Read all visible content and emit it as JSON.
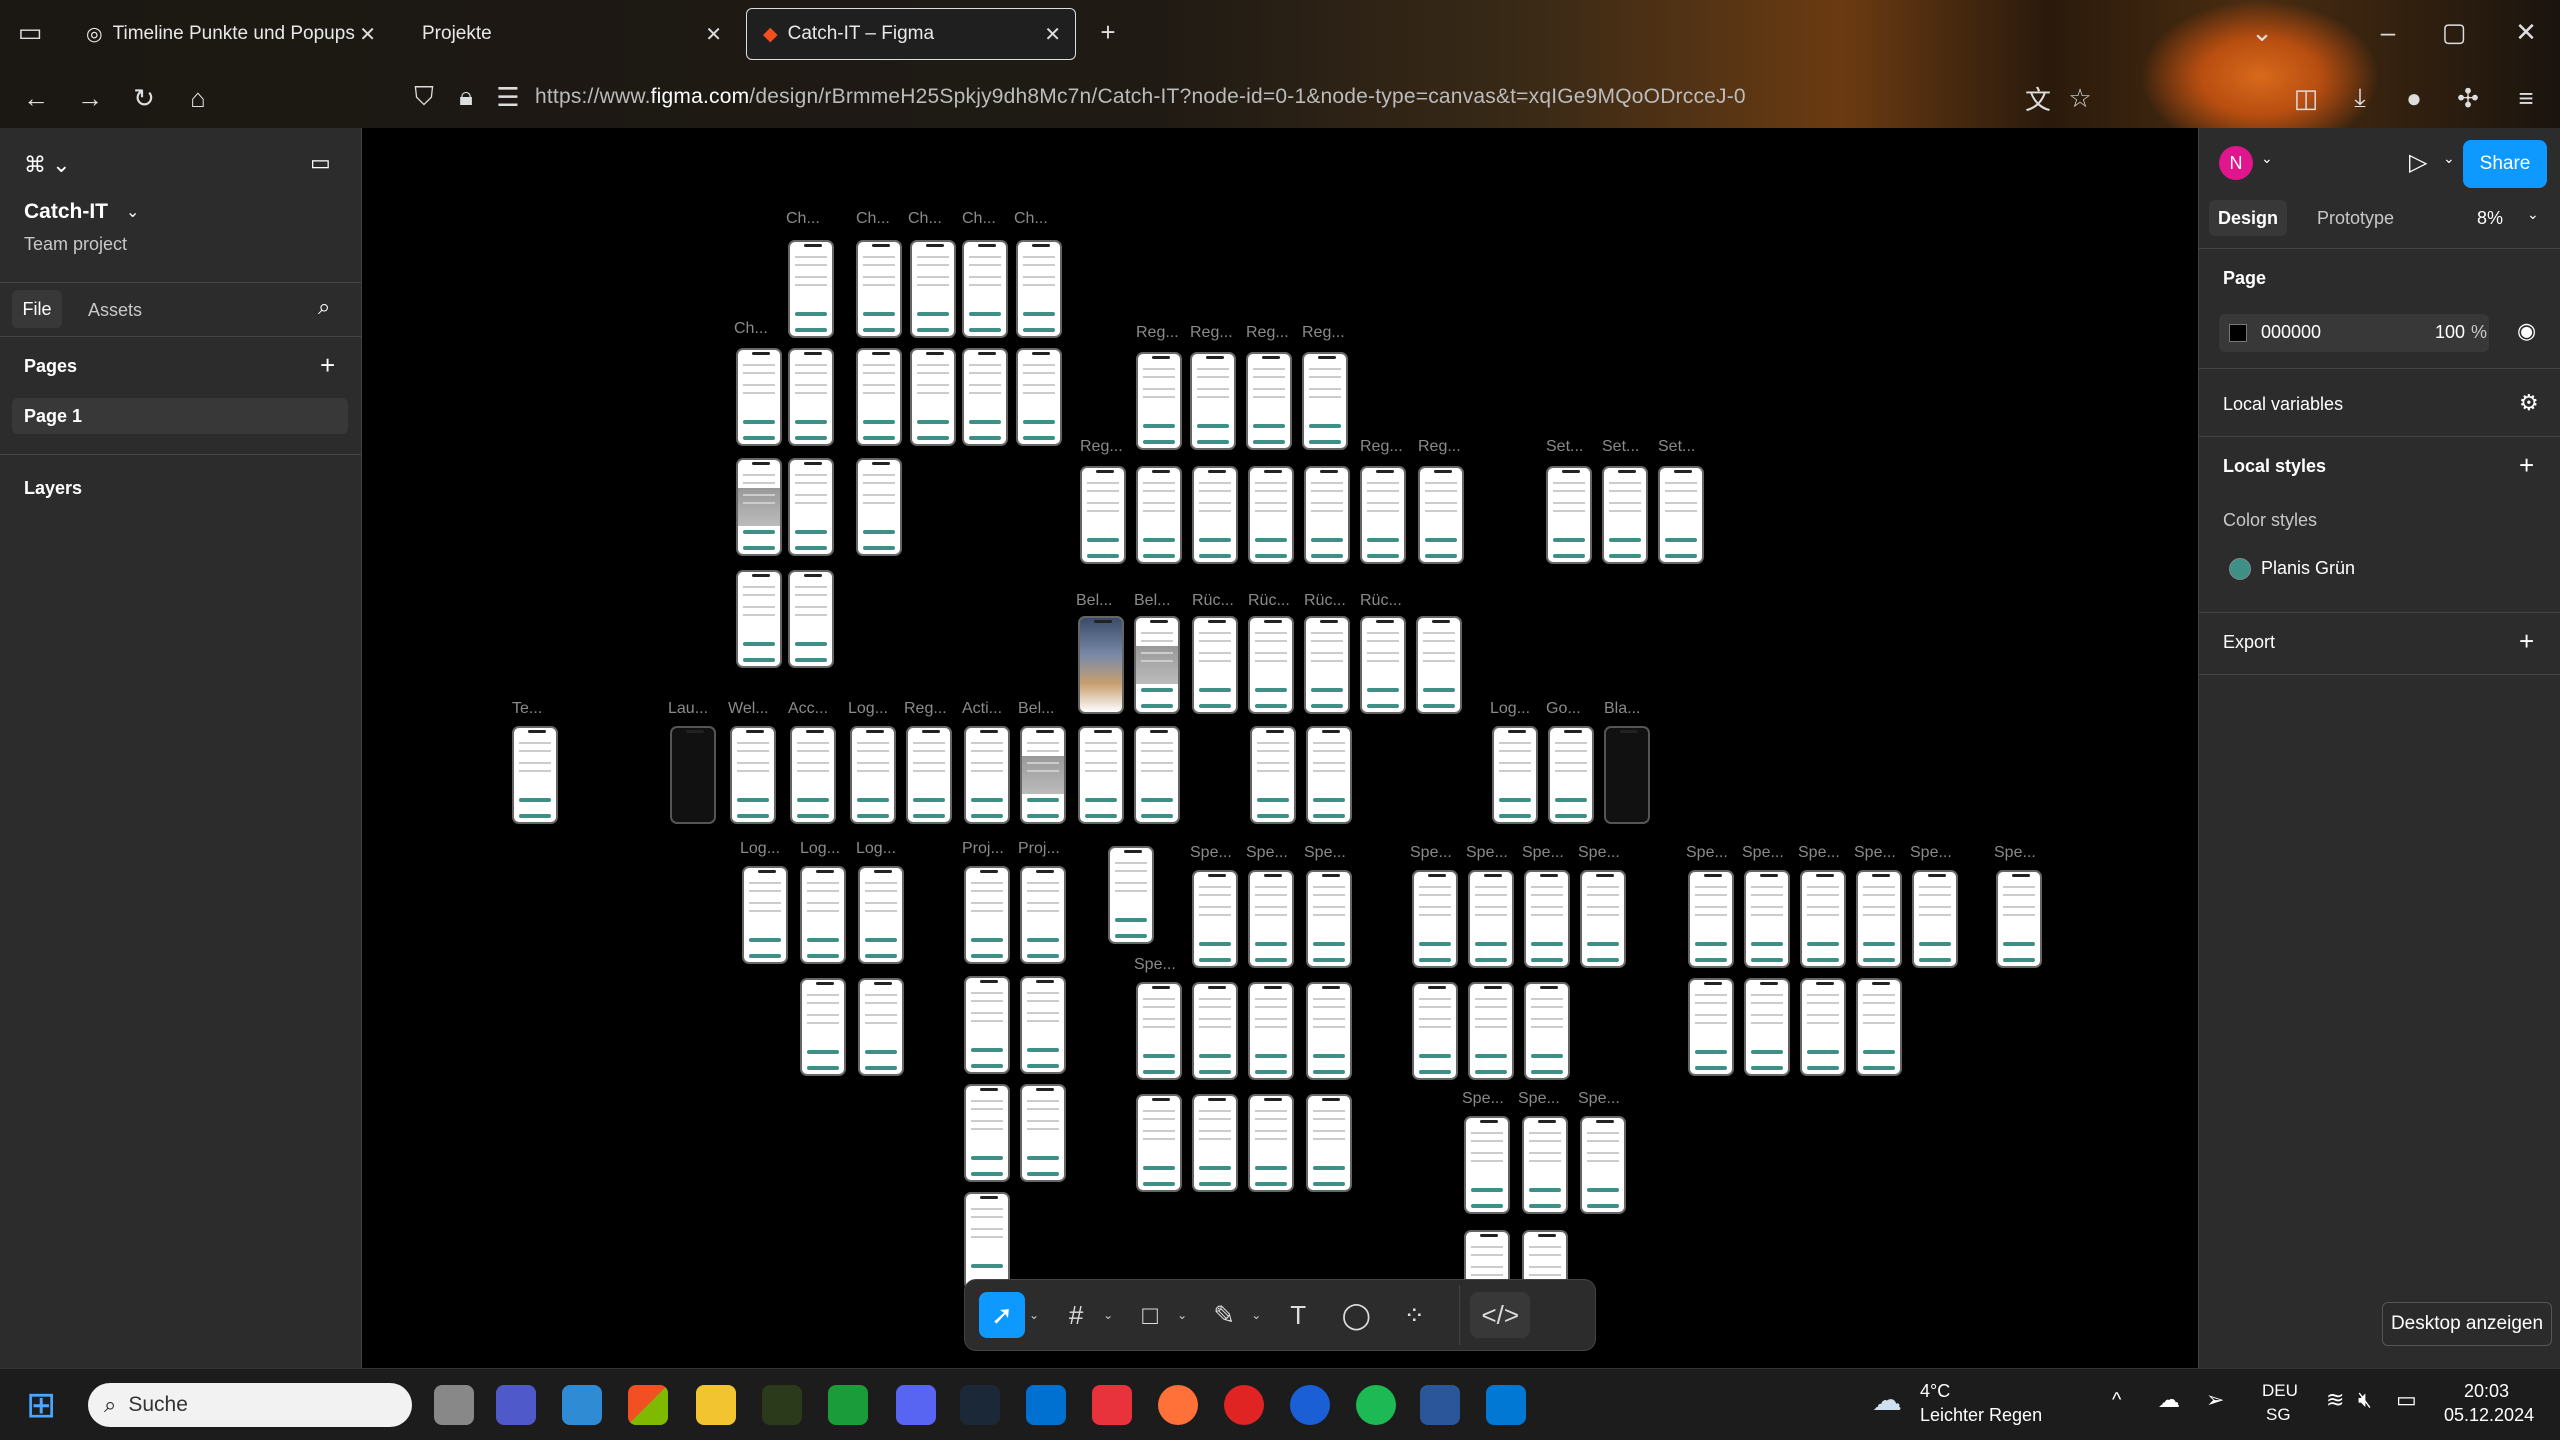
{
  "browser": {
    "tabs": [
      {
        "label": "Timeline Punkte und Popups"
      },
      {
        "label": "Projekte"
      },
      {
        "label": "Catch-IT – Figma"
      }
    ],
    "url_prefix": "https://www.",
    "url_domain": "figma.com",
    "url_rest": "/design/rBrmmeH25Spkjy9dh8Mc7n/Catch-IT?node-id=0-1&node-type=canvas&t=xqIGe9MQoODrcceJ-0"
  },
  "left": {
    "project": "Catch-IT",
    "team": "Team project",
    "tab_file": "File",
    "tab_assets": "Assets",
    "pages_title": "Pages",
    "page1": "Page 1",
    "layers_title": "Layers"
  },
  "right": {
    "avatar": "N",
    "share": "Share",
    "tab_design": "Design",
    "tab_prototype": "Prototype",
    "zoom": "8%",
    "page_title": "Page",
    "bg_color": "000000",
    "opacity": "100",
    "pct": "%",
    "local_variables": "Local variables",
    "local_styles": "Local styles",
    "color_styles": "Color styles",
    "style_name": "Planis Grün",
    "style_color": "#3e8f86",
    "export": "Export"
  },
  "canvas": {
    "labels": [
      "Ch...",
      "Ch...",
      "Ch...",
      "Ch...",
      "Ch...",
      "Ch...",
      "Reg...",
      "Reg...",
      "Reg...",
      "Reg...",
      "Reg...",
      "Reg...",
      "Reg...",
      "Set...",
      "Set...",
      "Set...",
      "Bel...",
      "Bel...",
      "Rüc...",
      "Rüc...",
      "Rüc...",
      "Rüc...",
      "Te...",
      "Lau...",
      "Wel...",
      "Acc...",
      "Log...",
      "Reg...",
      "Acti...",
      "Bel...",
      "Log...",
      "Go...",
      "Bla...",
      "Log...",
      "Log...",
      "Log...",
      "Proj...",
      "Proj...",
      "Spe...",
      "Spe...",
      "Spe...",
      "Spe...",
      "Spe...",
      "Spe...",
      "Spe...",
      "Spe...",
      "Spe...",
      "Spe...",
      "Spe...",
      "Spe...",
      "Spe...",
      "Spe...",
      "Spe...",
      "Spe...",
      "Spe..."
    ]
  },
  "tooltip": "Desktop anzeigen",
  "taskbar": {
    "search": "Suche",
    "weather_temp": "4°C",
    "weather_text": "Leichter Regen",
    "lang1": "DEU",
    "lang2": "SG",
    "time": "20:03",
    "date": "05.12.2024"
  }
}
